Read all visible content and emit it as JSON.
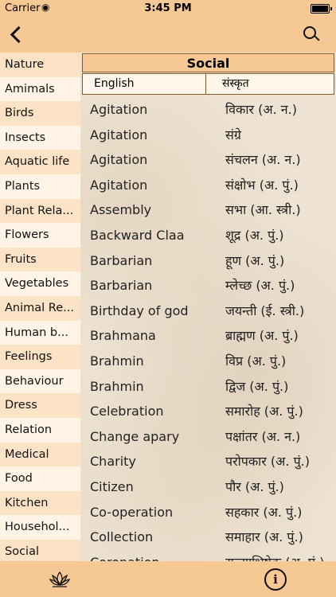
{
  "status": {
    "carrier": "Carrier",
    "time": "3:45 PM"
  },
  "sidebar": {
    "items": [
      "Nature",
      "Amimals",
      "Birds",
      "Insects",
      "Aquatic life",
      "Plants",
      "Plant Rela...",
      "Flowers",
      "Fruits",
      "Vegetables",
      "Animal Re...",
      "Human b...",
      "Feelings",
      "Behaviour",
      "Dress",
      "Relation",
      "Medical",
      "Food",
      "Kitchen",
      "Househol...",
      "Social"
    ],
    "selected": "Social"
  },
  "content": {
    "section_title": "Social",
    "col_english": "English",
    "col_sanskrit": "संस्कृत",
    "words": [
      [
        "Agitation",
        "विकार (अ. न.)"
      ],
      [
        "Agitation",
        "संग्रे"
      ],
      [
        "Agitation",
        "संचलन (अ. न.)"
      ],
      [
        "Agitation",
        "संक्षोभ (अ. पुं.)"
      ],
      [
        "Assembly",
        "सभा (आ. स्त्री.)"
      ],
      [
        "Backward Claa",
        "शूद्र (अ. पुं.)"
      ],
      [
        "Barbarian",
        "हूण (अ. पुं.)"
      ],
      [
        "Barbarian",
        "म्लेच्छ (अ. पुं.)"
      ],
      [
        "Birthday of god",
        "जयन्ती (ई. स्त्री.)"
      ],
      [
        "Brahmana",
        "ब्राह्मण (अ. पुं.)"
      ],
      [
        "Brahmin",
        "विप्र (अ. पुं.)"
      ],
      [
        "Brahmin",
        "द्विज (अ. पुं.)"
      ],
      [
        "Celebration",
        "समारोह (अ. पुं.)"
      ],
      [
        "Change apary",
        "पक्षांतर (अ. न.)"
      ],
      [
        "Charity",
        "परोपकार (अ. पुं.)"
      ],
      [
        "Citizen",
        "पौर (अ. पुं.)"
      ],
      [
        "Co-operation",
        "सहकार (अ. पुं.)"
      ],
      [
        "Collection",
        "समाहार (अ. पुं.)"
      ],
      [
        "Coronation",
        "राज्याभिषेक (अ. पुं.)"
      ]
    ]
  },
  "icons": {
    "back": "chevron-left-icon",
    "search": "search-icon",
    "lotus": "lotus-icon",
    "info": "info-icon"
  },
  "colors": {
    "accent": "#f6c894",
    "sidebar_bg": "#fde3c6",
    "border": "#8a5a28"
  }
}
